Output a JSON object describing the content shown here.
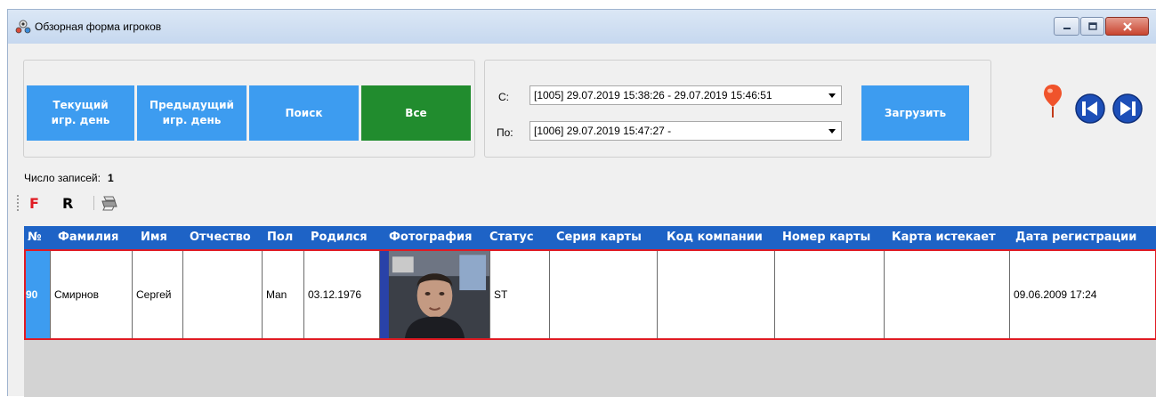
{
  "window": {
    "title": "Обзорная форма игроков"
  },
  "buttons": {
    "current_day_line1": "Текущий",
    "current_day_line2": "игр. день",
    "previous_day_line1": "Предыдущий",
    "previous_day_line2": "игр. день",
    "search": "Поиск",
    "all": "Все",
    "load": "Загрузить"
  },
  "range": {
    "from_label": "С:",
    "from_value": "[1005] 29.07.2019 15:38:26 - 29.07.2019 15:46:51",
    "to_label": "По:",
    "to_value": "[1006] 29.07.2019 15:47:27 -"
  },
  "records": {
    "label": "Число записей:",
    "count": "1"
  },
  "toolbar": {
    "f_label": "F",
    "r_label": "R"
  },
  "table": {
    "columns": [
      "№",
      "Фамилия",
      "Имя",
      "Отчество",
      "Пол",
      "Родился",
      "Фотография",
      "Статус",
      "Серия карты",
      "Код компании",
      "Номер карты",
      "Карта истекает",
      "Дата регистрации"
    ],
    "rows": [
      {
        "num": "90",
        "surname": "Смирнов",
        "name": "Сергей",
        "patronymic": "",
        "gender": "Man",
        "born": "03.12.1976",
        "status": "ST",
        "card_series": "",
        "company_code": "",
        "card_number": "",
        "card_expires": "",
        "registered": "09.06.2009 17:24"
      }
    ]
  },
  "colors": {
    "tile_blue": "#3d9cf0",
    "tile_green": "#218c2e",
    "header_blue": "#1e63c6",
    "selection_red": "#e01b23"
  }
}
